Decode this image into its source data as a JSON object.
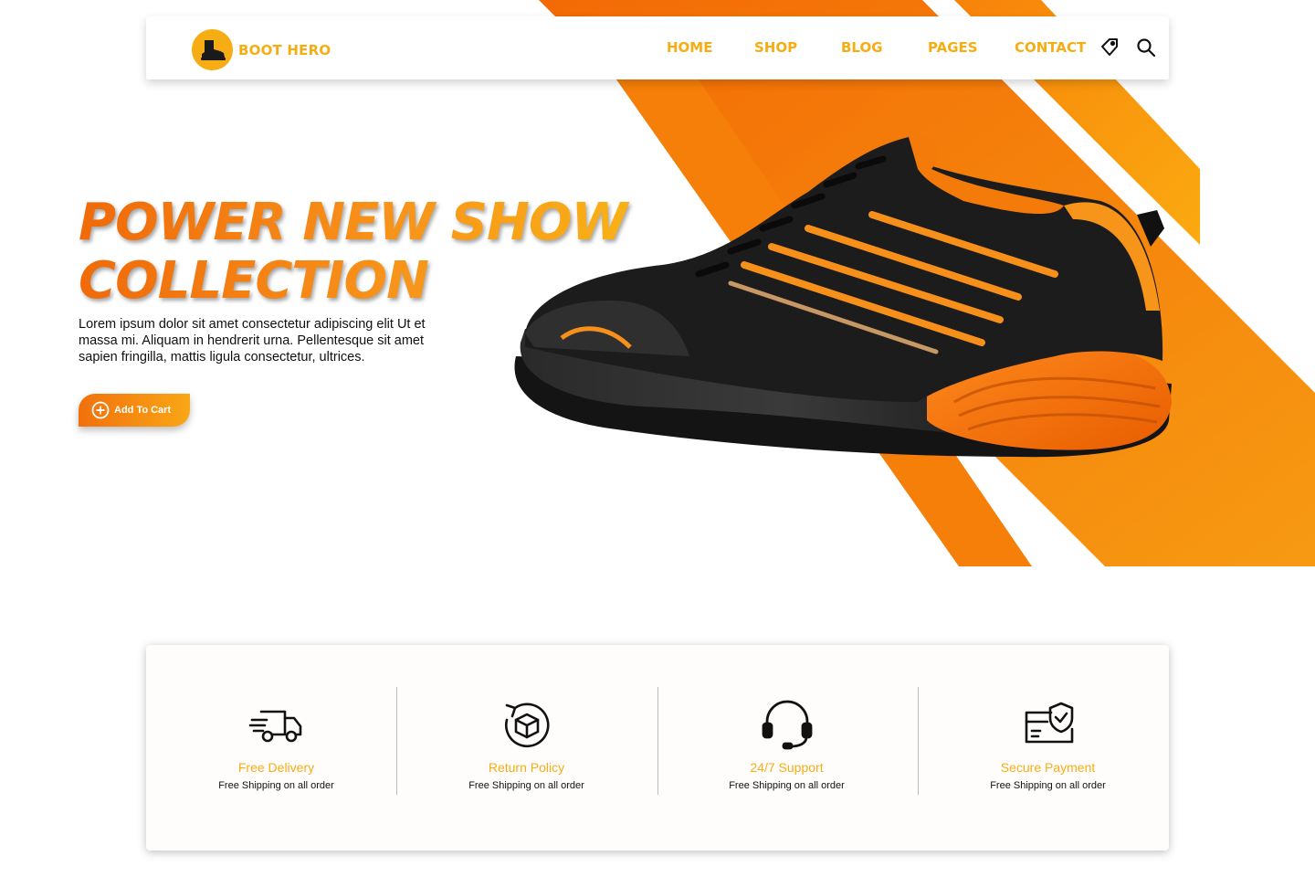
{
  "brand": {
    "name": "BOOT HERO",
    "color": "#f6ad14"
  },
  "nav": {
    "links": [
      "HOME",
      "SHOP",
      "BLOG",
      "PAGES",
      "CONTACT"
    ],
    "icons": [
      "tag-icon",
      "search-icon"
    ]
  },
  "hero": {
    "title_line1": "POWER NEW SHOW",
    "title_line2": "COLLECTION",
    "description": "Lorem ipsum dolor sit amet consectetur adipiscing elit Ut et massa mi. Aliquam in hendrerit urna. Pellentesque sit amet sapien fringilla, mattis ligula consectetur, ultrices.",
    "cta_label": "Add To Cart",
    "cta_icon": "plus-circle-icon",
    "image": "orange-black-sneaker"
  },
  "features": [
    {
      "icon": "delivery-truck-icon",
      "title": "Free Delivery",
      "subtitle": "Free Shipping on all order"
    },
    {
      "icon": "return-box-icon",
      "title": "Return Policy",
      "subtitle": "Free Shipping on all order"
    },
    {
      "icon": "headset-icon",
      "title": "24/7 Support",
      "subtitle": "Free Shipping on all order"
    },
    {
      "icon": "secure-card-icon",
      "title": "Secure Payment",
      "subtitle": "Free Shipping on all order"
    }
  ],
  "colors": {
    "accent": "#f6ad14",
    "orange": "#f47a0a",
    "dark": "#111111"
  }
}
